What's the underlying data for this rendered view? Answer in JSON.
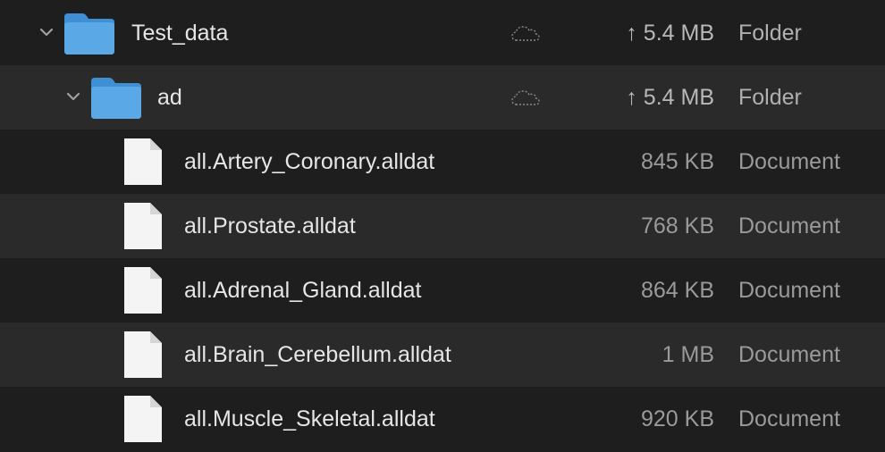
{
  "rows": [
    {
      "type": "folder",
      "name": "Test_data",
      "expanded": true,
      "cloud": "cloud-outline-icon",
      "size": "↑ 5.4 MB",
      "kind": "Folder"
    },
    {
      "type": "folder",
      "name": "ad",
      "expanded": true,
      "cloud": "cloud-outline-icon",
      "size": "↑ 5.4 MB",
      "kind": "Folder"
    },
    {
      "type": "document",
      "name": "all.Artery_Coronary.alldat",
      "size": "845 KB",
      "kind": "Document"
    },
    {
      "type": "document",
      "name": "all.Prostate.alldat",
      "size": "768 KB",
      "kind": "Document"
    },
    {
      "type": "document",
      "name": "all.Adrenal_Gland.alldat",
      "size": "864 KB",
      "kind": "Document"
    },
    {
      "type": "document",
      "name": "all.Brain_Cerebellum.alldat",
      "size": "1 MB",
      "kind": "Document"
    },
    {
      "type": "document",
      "name": "all.Muscle_Skeletal.alldat",
      "size": "920 KB",
      "kind": "Document"
    }
  ],
  "colors": {
    "background": "#1e1e1e",
    "row_alt": "#2a2a2a",
    "folder_blue": "#5aa9e6",
    "text": "#e6e6e6",
    "secondary_text": "#9a9a9a"
  }
}
